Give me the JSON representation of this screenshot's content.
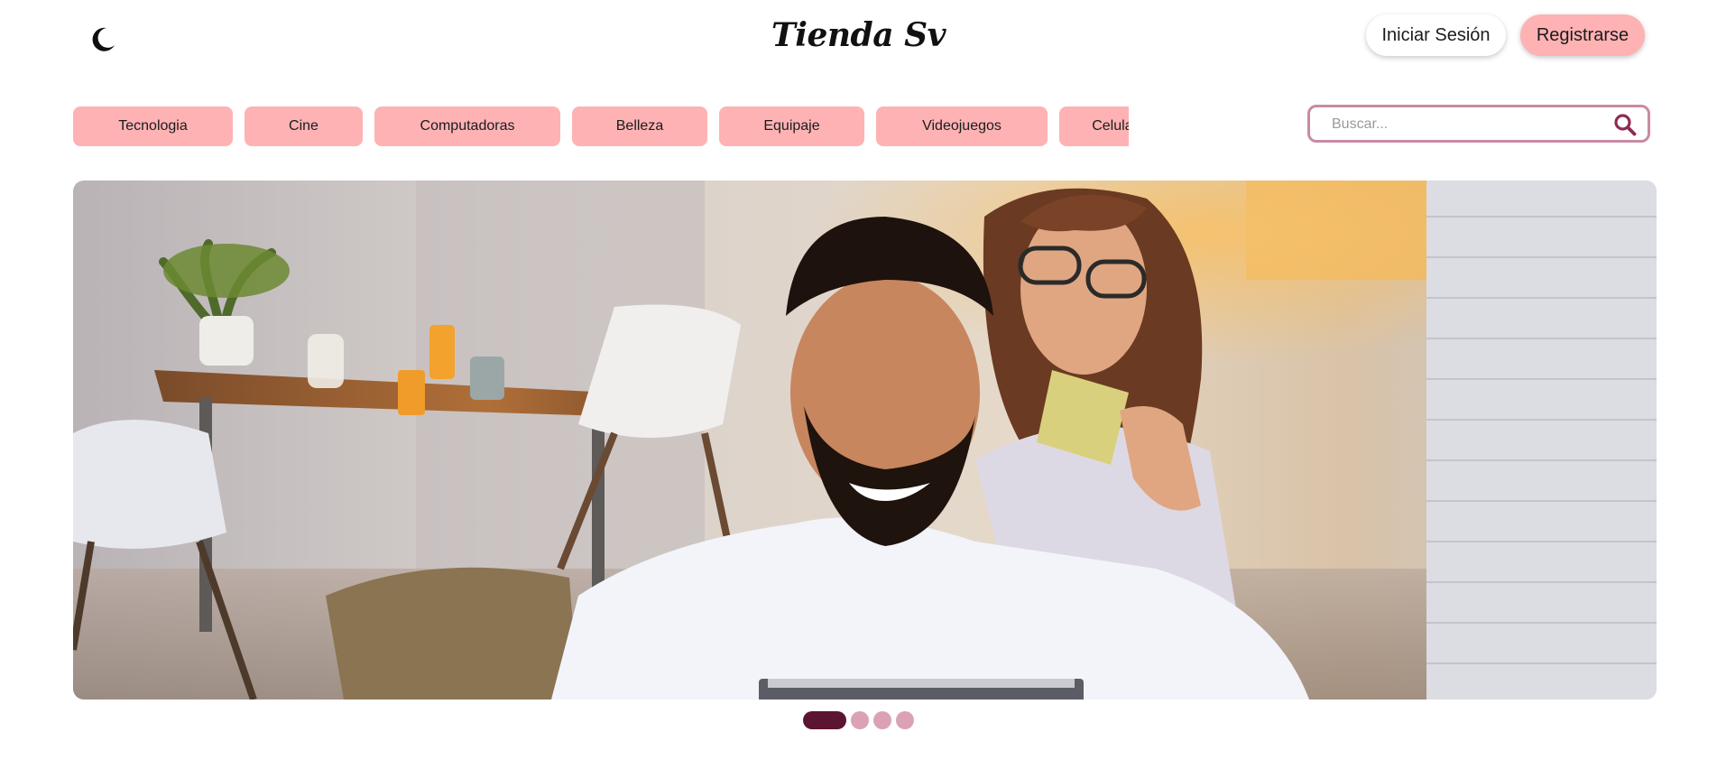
{
  "header": {
    "theme_toggle_icon": "moon-icon",
    "brand": "Tienda Sv",
    "login_label": "Iniciar Sesión",
    "register_label": "Registrarse"
  },
  "categories": [
    "Tecnologia",
    "Cine",
    "Computadoras",
    "Belleza",
    "Equipaje",
    "Videojuegos",
    "Celulares"
  ],
  "search": {
    "placeholder": "Buscar...",
    "icon": "search-icon"
  },
  "carousel": {
    "slide_count": 4,
    "active_index": 0
  },
  "colors": {
    "category_bg": "#feb2b4",
    "register_bg": "#feb2b4",
    "search_border": "#c98aa5",
    "search_icon": "#8e2b55",
    "dot_active": "#5c1530",
    "dot_inactive": "#dba2b5"
  }
}
